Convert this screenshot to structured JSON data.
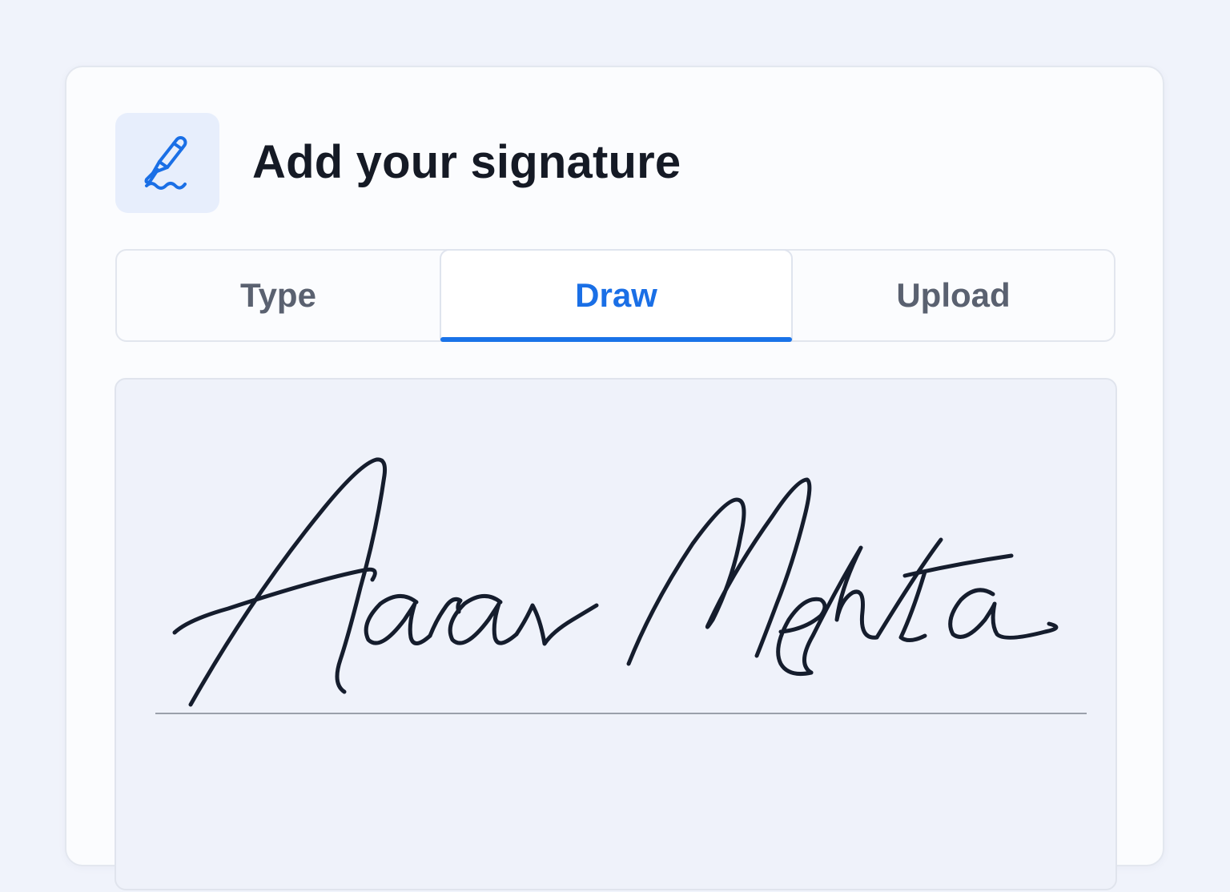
{
  "header": {
    "title": "Add your signature",
    "icon": "pen-signature-icon"
  },
  "tabs": [
    {
      "label": "Type",
      "active": false
    },
    {
      "label": "Draw",
      "active": true
    },
    {
      "label": "Upload",
      "active": false
    }
  ],
  "signature_pad": {
    "signature": "Aarav Mehta",
    "signature_style": "handwritten-drawn"
  },
  "colors": {
    "accent": "#1a73e8",
    "ink": "#151d2d",
    "background": "#f0f3fb"
  }
}
